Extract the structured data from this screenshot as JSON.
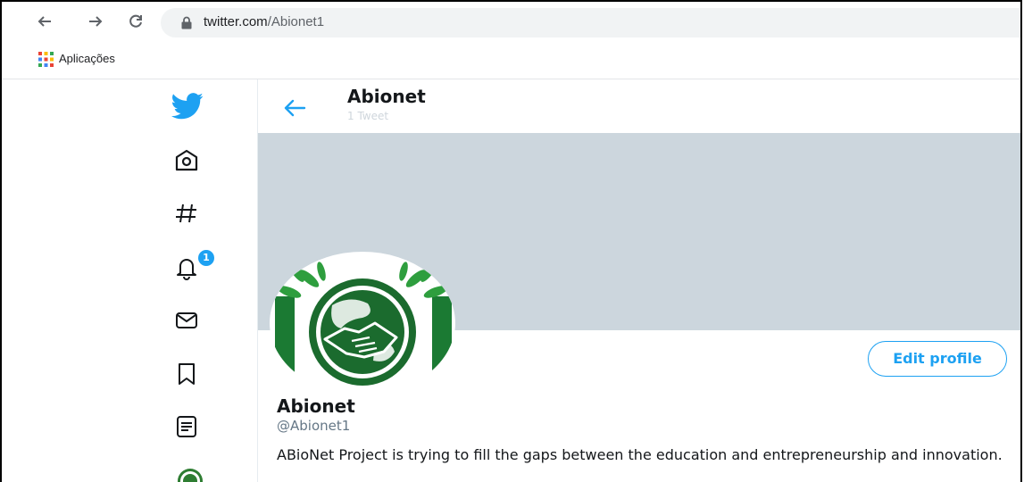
{
  "browser": {
    "url_host": "twitter.com",
    "url_path": "/Abionet1",
    "bookmarks": {
      "apps_label": "Aplicações"
    },
    "icons": [
      "back-arrow-icon",
      "forward-arrow-icon",
      "reload-icon",
      "lock-icon",
      "apps-grid-icon"
    ]
  },
  "sidebar": {
    "items": [
      {
        "name": "twitter-logo",
        "icon": "bird-icon"
      },
      {
        "name": "home",
        "icon": "home-icon"
      },
      {
        "name": "explore",
        "icon": "hashtag-icon"
      },
      {
        "name": "notifications",
        "icon": "bell-icon",
        "badge": "1"
      },
      {
        "name": "messages",
        "icon": "envelope-icon"
      },
      {
        "name": "bookmarks",
        "icon": "bookmark-icon"
      },
      {
        "name": "lists",
        "icon": "list-icon"
      },
      {
        "name": "profile",
        "icon": "avatar-icon"
      }
    ]
  },
  "header": {
    "title": "Abionet",
    "subtitle": "1 Tweet"
  },
  "profile": {
    "edit_label": "Edit profile",
    "name": "Abionet",
    "handle": "@Abionet1",
    "bio": "ABioNet Project is trying to fill the gaps between the education and entrepreneurship and innovation."
  },
  "colors": {
    "accent": "#1da1f2",
    "banner": "#ccd6dd",
    "logo_green": "#2e7d32"
  }
}
